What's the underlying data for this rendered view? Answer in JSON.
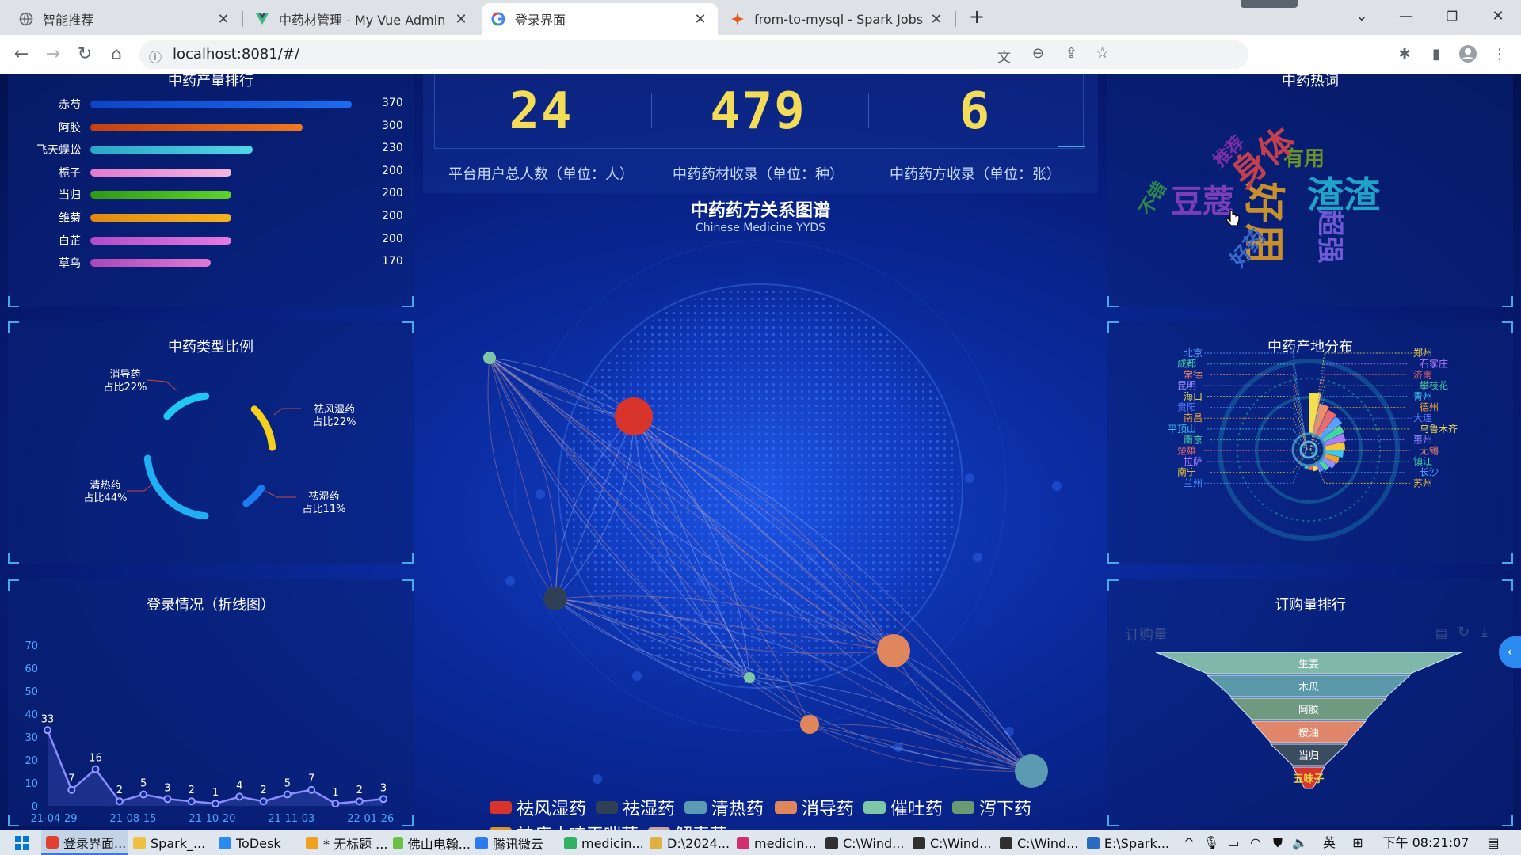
{
  "browser": {
    "tabs": [
      {
        "label": "智能推荐",
        "icon": "globe-icon",
        "active": false
      },
      {
        "label": "中药材管理 - My Vue Admin",
        "icon": "vue-icon",
        "active": false
      },
      {
        "label": "登录界面",
        "icon": "google-icon",
        "active": true
      },
      {
        "label": "from-to-mysql - Spark Jobs",
        "icon": "spark-icon",
        "active": false
      }
    ],
    "new_tab": "+",
    "url": "localhost:8081/#/"
  },
  "rank_panel": {
    "title": "中药产量排行",
    "items": [
      {
        "name": "赤芍",
        "value": 370,
        "color": "#1a6cf0",
        "color2": "#0c44c8"
      },
      {
        "name": "阿胶",
        "value": 300,
        "color": "#f0781e",
        "color2": "#c44010"
      },
      {
        "name": "飞天蜈蚣",
        "value": 230,
        "color": "#4fd6e6",
        "color2": "#2aa6c8"
      },
      {
        "name": "栀子",
        "value": 200,
        "color": "#f2b8e0",
        "color2": "#e07ad0"
      },
      {
        "name": "当归",
        "value": 200,
        "color": "#5ed22a",
        "color2": "#2e9a16"
      },
      {
        "name": "雏菊",
        "value": 200,
        "color": "#f6b21e",
        "color2": "#e08a10"
      },
      {
        "name": "白芷",
        "value": 200,
        "color": "#e67ae6",
        "color2": "#b04cc8"
      },
      {
        "name": "草乌",
        "value": 170,
        "color": "#e07ad6",
        "color2": "#a848b8"
      }
    ],
    "max": 370
  },
  "type_panel": {
    "title": "中药类型比例",
    "slices": [
      {
        "label": "消导药",
        "pct_text": "占比22%",
        "color": "#1fc8f4"
      },
      {
        "label": "祛风湿药",
        "pct_text": "占比22%",
        "color": "#f4d01c"
      },
      {
        "label": "祛湿药",
        "pct_text": "占比11%",
        "color": "#1a7cf0"
      },
      {
        "label": "清热药",
        "pct_text": "占比44%",
        "color": "#1fb0f4"
      }
    ]
  },
  "login_panel": {
    "title": "登录情况（折线图）",
    "yticks": [
      "0",
      "10",
      "20",
      "30",
      "40",
      "50",
      "60",
      "70"
    ],
    "xticks": [
      "21-04-29",
      "21-08-15",
      "21-10-20",
      "21-11-03",
      "22-01-26"
    ],
    "values": [
      33,
      7,
      16,
      2,
      5,
      3,
      2,
      1,
      4,
      2,
      5,
      7,
      1,
      2,
      3
    ],
    "labels": [
      "33",
      "7",
      "16",
      "2",
      "5",
      "3",
      "2",
      "1",
      "4",
      "2",
      "5",
      "7",
      "1",
      "2",
      "3"
    ]
  },
  "stats": [
    {
      "value": "24",
      "label": "平台用户总人数（单位：人）"
    },
    {
      "value": "479",
      "label": "中药药材收录（单位：种）"
    },
    {
      "value": "6",
      "label": "中药药方收录（单位：张）"
    }
  ],
  "graph": {
    "title": "中药药方关系图谱",
    "subtitle": "Chinese Medicine YYDS",
    "legend": [
      {
        "label": "祛风湿药",
        "color": "#d8342c"
      },
      {
        "label": "祛湿药",
        "color": "#2f3f55"
      },
      {
        "label": "清热药",
        "color": "#5a9ab2"
      },
      {
        "label": "消导药",
        "color": "#e0865c"
      },
      {
        "label": "催吐药",
        "color": "#7ec6a8"
      },
      {
        "label": "泻下药",
        "color": "#6a9a72"
      },
      {
        "label": "祛痰止咳平喘药",
        "color": "#d8962a"
      },
      {
        "label": "解表药",
        "color": "#c8a6a0"
      }
    ]
  },
  "wordcloud": {
    "title": "中药热词",
    "words": [
      {
        "text": "豆蔻",
        "color": "#7a3fb8"
      },
      {
        "text": "渣渣",
        "color": "#1fa3c8"
      },
      {
        "text": "有用",
        "color": "#6b8f2a"
      },
      {
        "text": "不错",
        "color": "#2a8a4a"
      },
      {
        "text": "推荐",
        "color": "#7c2fa6"
      },
      {
        "text": "好用",
        "color": "#c8902a"
      },
      {
        "text": "身体",
        "color": "#c04050"
      },
      {
        "text": "超强",
        "color": "#6f5ad6"
      },
      {
        "text": "好药",
        "color": "#3a6ac8"
      }
    ]
  },
  "origin_panel": {
    "title": "中药产地分布",
    "left_cities": [
      {
        "name": "北京",
        "color": "#5aa0ff"
      },
      {
        "name": "成都",
        "color": "#3fd6a6"
      },
      {
        "name": "常德",
        "color": "#f08a6a"
      },
      {
        "name": "昆明",
        "color": "#9a8aff"
      },
      {
        "name": "海口",
        "color": "#f4e04a"
      },
      {
        "name": "贵阳",
        "color": "#5a7aff"
      },
      {
        "name": "南昌",
        "color": "#f0a030"
      },
      {
        "name": "平顶山",
        "color": "#3ac8f0"
      },
      {
        "name": "南京",
        "color": "#4ad6a0"
      },
      {
        "name": "楚雄",
        "color": "#f06a6a"
      },
      {
        "name": "拉萨",
        "color": "#b07aff"
      },
      {
        "name": "南宁",
        "color": "#f4c830"
      },
      {
        "name": "兰州",
        "color": "#4a8aff"
      }
    ],
    "right_cities": [
      {
        "name": "郑州",
        "color": "#f4e04a"
      },
      {
        "name": "石家庄",
        "color": "#b07aff"
      },
      {
        "name": "济南",
        "color": "#f06a6a"
      },
      {
        "name": "攀枝花",
        "color": "#4ad6a0"
      },
      {
        "name": "青州",
        "color": "#3ac8f0"
      },
      {
        "name": "德州",
        "color": "#f0a030"
      },
      {
        "name": "大连",
        "color": "#5a7aff"
      },
      {
        "name": "乌鲁木齐",
        "color": "#f4e04a"
      },
      {
        "name": "惠州",
        "color": "#9a8aff"
      },
      {
        "name": "无锡",
        "color": "#f08a6a"
      },
      {
        "name": "镇江",
        "color": "#3fd6a6"
      },
      {
        "name": "长沙",
        "color": "#5aa0ff"
      },
      {
        "name": "苏州",
        "color": "#f4c830"
      }
    ]
  },
  "order_panel": {
    "title": "订购量排行",
    "series_label": "订购量",
    "levels": [
      {
        "name": "生姜",
        "color": "#7fb8a8"
      },
      {
        "name": "木瓜",
        "color": "#5a98aa"
      },
      {
        "name": "阿胶",
        "color": "#6f9a80"
      },
      {
        "name": "桉油",
        "color": "#e0866a"
      },
      {
        "name": "当归",
        "color": "#3a4c60"
      },
      {
        "name": "五味子",
        "color": "#d8342c"
      }
    ]
  },
  "taskbar": {
    "items": [
      {
        "label": "登录界面...",
        "color": "#e04030"
      },
      {
        "label": "Spark_...",
        "color": "#f0c040"
      },
      {
        "label": "ToDesk",
        "color": "#2a8af0"
      },
      {
        "label": "* 无标题 ...",
        "color": "#f0a020"
      },
      {
        "label": "佛山电翰...",
        "color": "#6ac040"
      },
      {
        "label": "腾讯微云",
        "color": "#2a7af0"
      },
      {
        "label": "medicin...",
        "color": "#30b060"
      },
      {
        "label": "D:\\2024...",
        "color": "#e0b040"
      },
      {
        "label": "medicin...",
        "color": "#d03070"
      },
      {
        "label": "C:\\Wind...",
        "color": "#303030"
      },
      {
        "label": "C:\\Wind...",
        "color": "#303030"
      },
      {
        "label": "C:\\Wind...",
        "color": "#303030"
      },
      {
        "label": "E:\\Spark...",
        "color": "#2a6ac0"
      }
    ],
    "ime": "英",
    "time": "下午 08:21:07"
  }
}
